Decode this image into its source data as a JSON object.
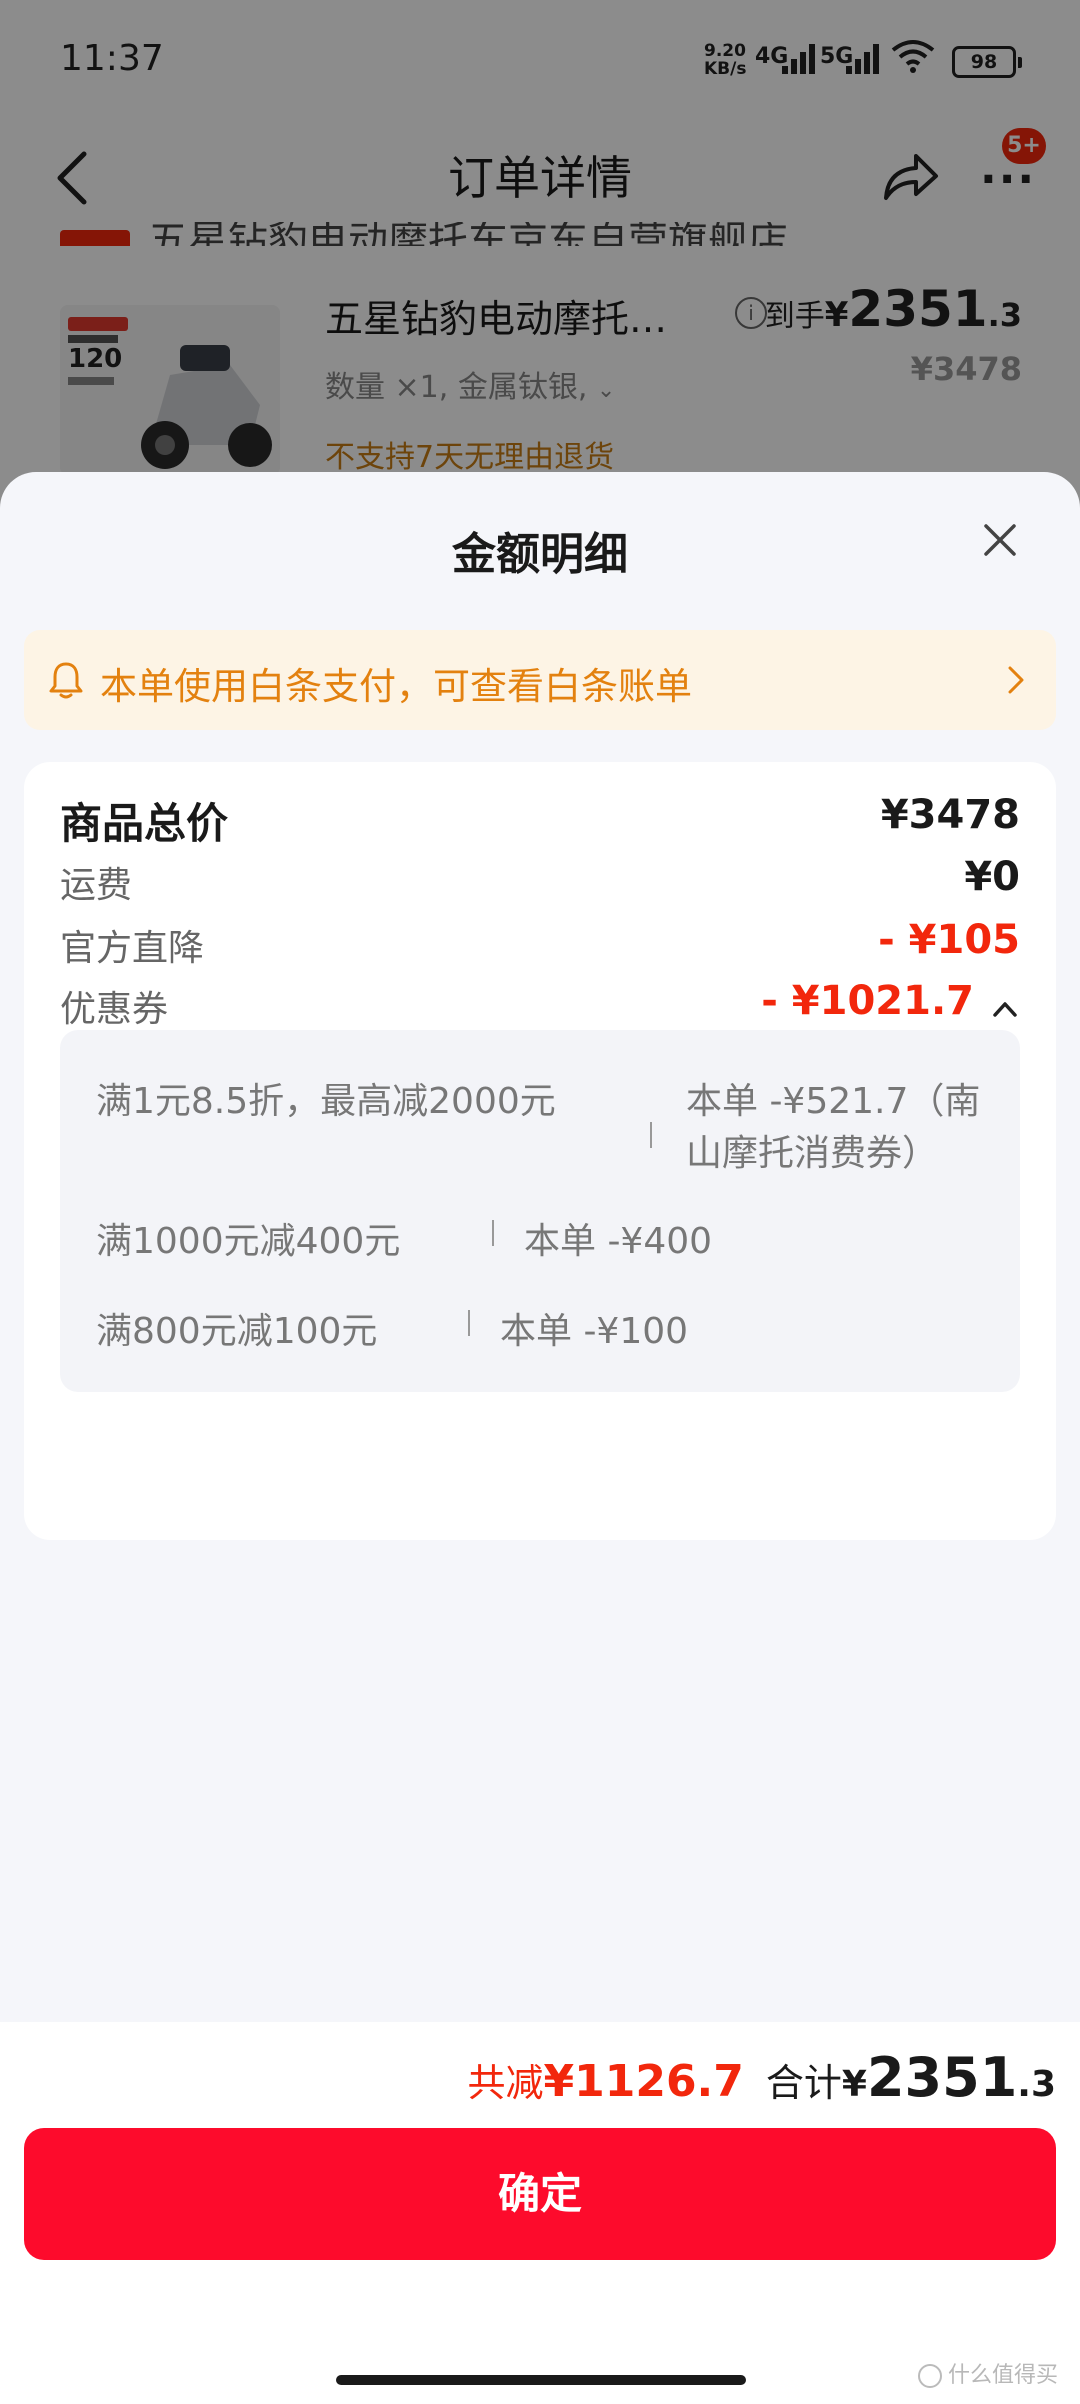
{
  "status": {
    "time": "11:37",
    "speed": "9.20",
    "speed_unit": "KB/s",
    "net1": "4G",
    "net2": "5G",
    "battery": "98"
  },
  "nav": {
    "title": "订单详情",
    "badge": "5+"
  },
  "background": {
    "cut_text": "五星钻豹电动摩托车京东自营旗舰店",
    "product_name": "五星钻豹电动摩托…",
    "price_label": "到手",
    "price_yen": "¥",
    "price_int": "2351",
    "price_dec": ".3",
    "orig_price": "¥3478",
    "spec": "数量 ×1, 金属钛银,",
    "no_return": "不支持7天无理由退货",
    "image_text": "120"
  },
  "sheet": {
    "title": "金额明细",
    "notice": "本单使用白条支付，可查看白条账单",
    "rows": {
      "total": {
        "label": "商品总价",
        "value": "¥3478"
      },
      "shipping": {
        "label": "运费",
        "value": "¥0"
      },
      "official": {
        "label": "官方直降",
        "value": "- ¥105"
      },
      "coupon": {
        "label": "优惠券",
        "value": "- ¥1021.7"
      }
    },
    "coupons": [
      {
        "rule": "满1元8.5折，最高减2000元",
        "amount_line1": "本单 -¥521.7（南",
        "amount_line2": "山摩托消费券）"
      },
      {
        "rule": "满1000元减400元",
        "amount": "本单 -¥400"
      },
      {
        "rule": "满800元减100元",
        "amount": "本单 -¥100"
      }
    ]
  },
  "footer": {
    "save_label": "共减",
    "save_value": "¥1126.7",
    "total_label": "合计",
    "total_yen": "¥",
    "total_int": "2351",
    "total_dec": ".3",
    "confirm": "确定",
    "watermark": "什么值得买"
  },
  "colors": {
    "accent_red": "#f2270c",
    "button_red": "#fd0b2c",
    "notice_text": "#e3810f",
    "notice_bg": "#fdf4e5"
  }
}
